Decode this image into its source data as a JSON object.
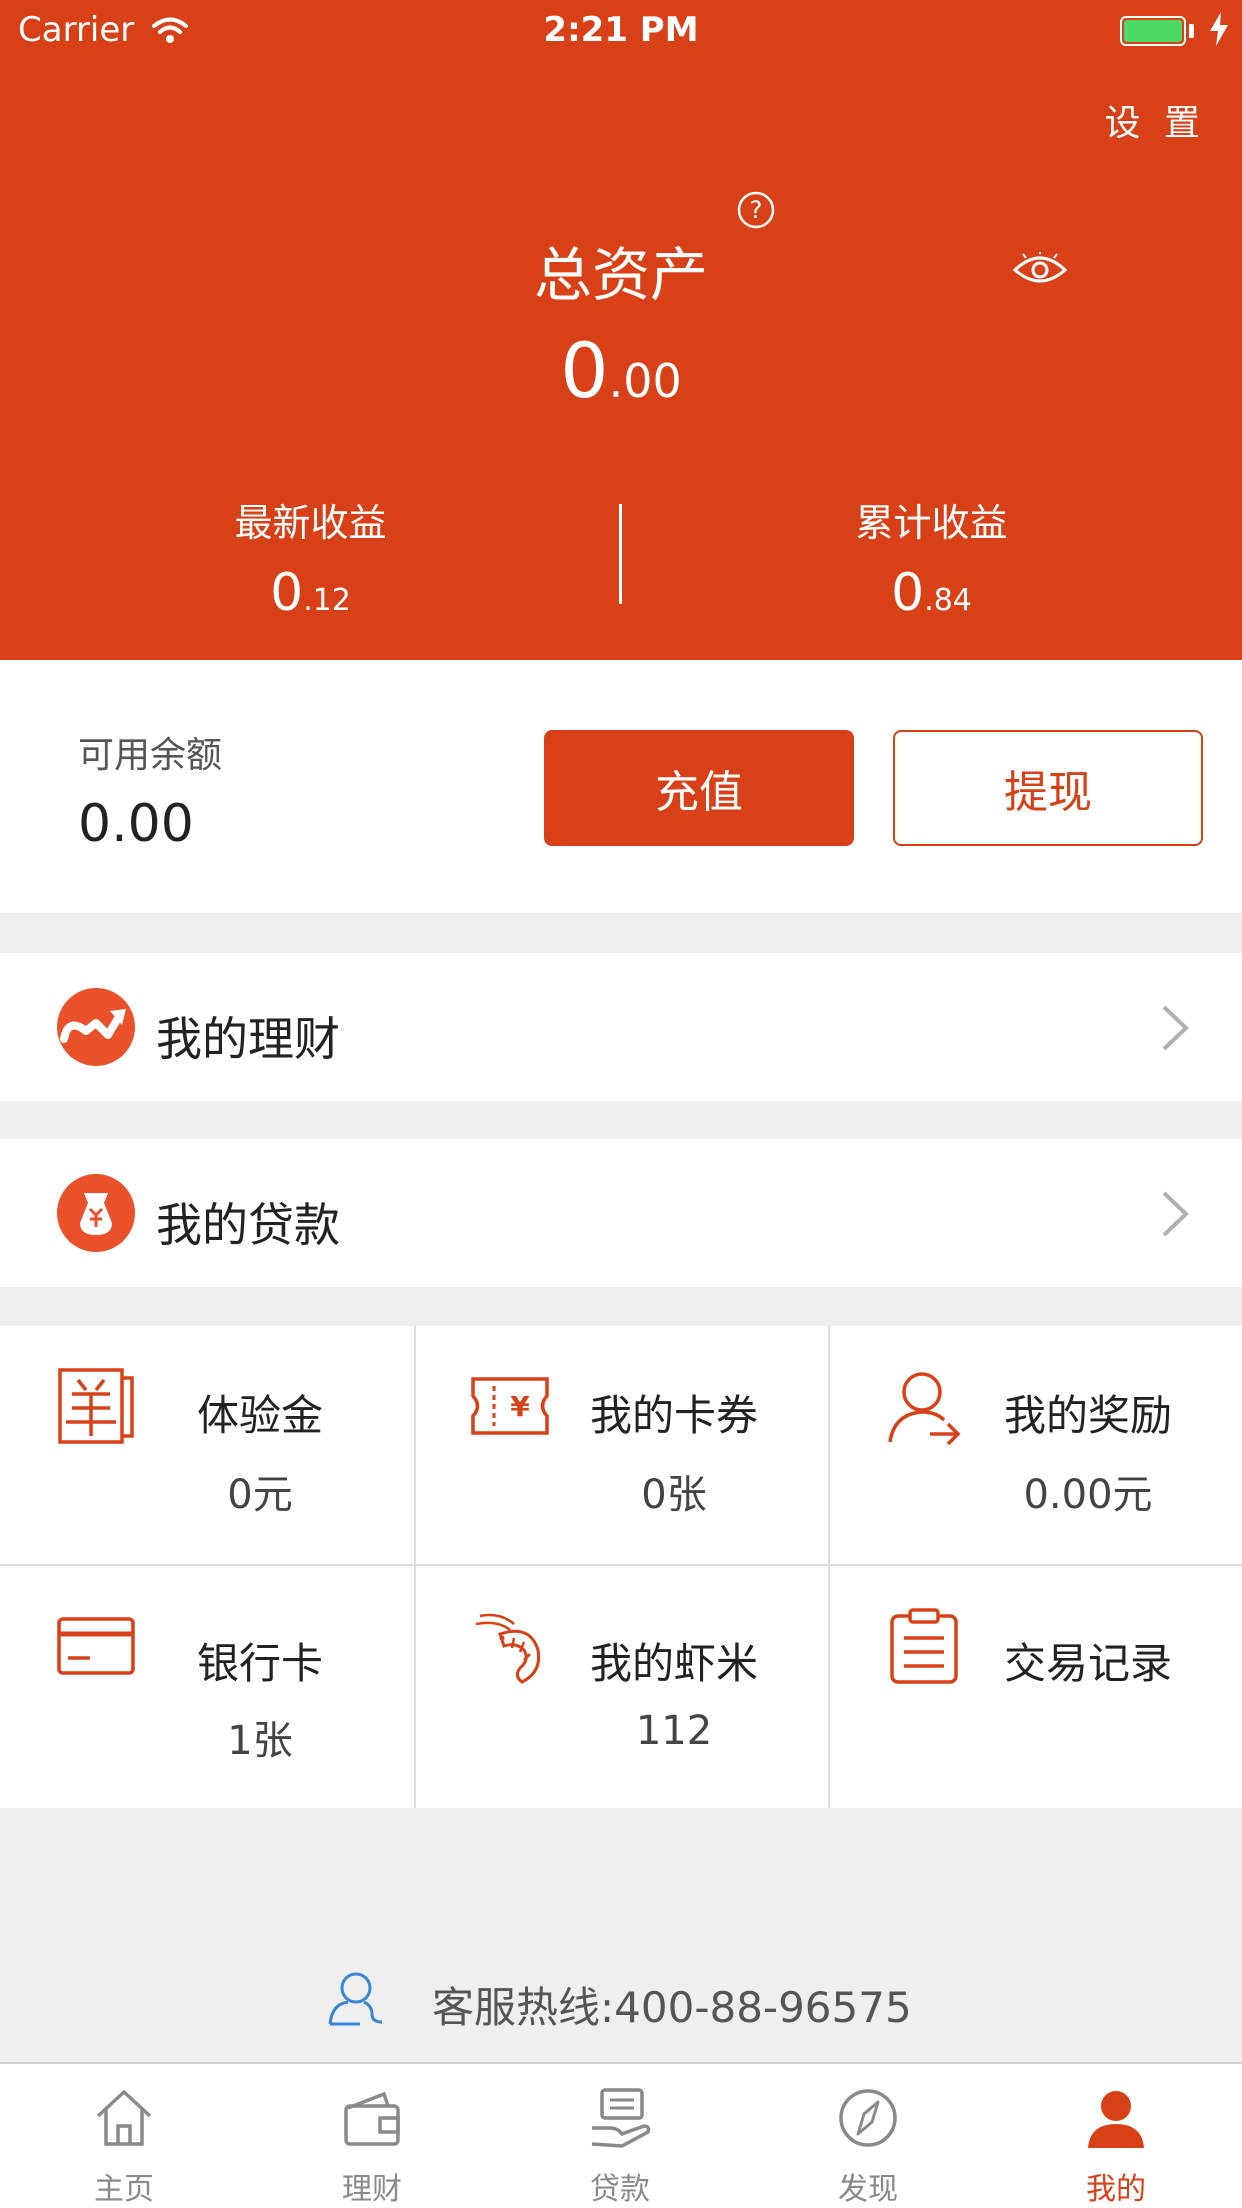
{
  "status_bar": {
    "carrier": "Carrier",
    "time": "2:21 PM"
  },
  "header": {
    "settings_label": "设 置",
    "total_title": "总资产",
    "total_int": "0",
    "total_dec": ".00",
    "latest_label": "最新收益",
    "latest_int": "0",
    "latest_dec": ".12",
    "cumulative_label": "累计收益",
    "cumulative_int": "0",
    "cumulative_dec": ".84"
  },
  "balance": {
    "label": "可用余额",
    "value": "0.00",
    "recharge_label": "充值",
    "withdraw_label": "提现"
  },
  "menu": {
    "invest_label": "我的理财",
    "loan_label": "我的贷款"
  },
  "grid": [
    {
      "title": "体验金",
      "value": "0元",
      "icon": "voucher-yang-icon"
    },
    {
      "title": "我的卡券",
      "value": "0张",
      "icon": "coupon-yuan-icon"
    },
    {
      "title": "我的奖励",
      "value": "0.00元",
      "icon": "user-share-icon"
    },
    {
      "title": "银行卡",
      "value": "1张",
      "icon": "bank-card-icon"
    },
    {
      "title": "我的虾米",
      "value": "112",
      "icon": "shrimp-icon"
    },
    {
      "title": "交易记录",
      "value": "",
      "icon": "clipboard-icon"
    }
  ],
  "hotline": "客服热线:400-88-96575",
  "tabs": [
    {
      "label": "主页",
      "icon": "home-icon"
    },
    {
      "label": "理财",
      "icon": "wallet-icon"
    },
    {
      "label": "贷款",
      "icon": "loan-icon"
    },
    {
      "label": "发现",
      "icon": "compass-icon"
    },
    {
      "label": "我的",
      "icon": "profile-icon",
      "active": true
    }
  ],
  "colors": {
    "brand": "#d84117",
    "background": "#efefef",
    "battery": "#4cd964"
  }
}
